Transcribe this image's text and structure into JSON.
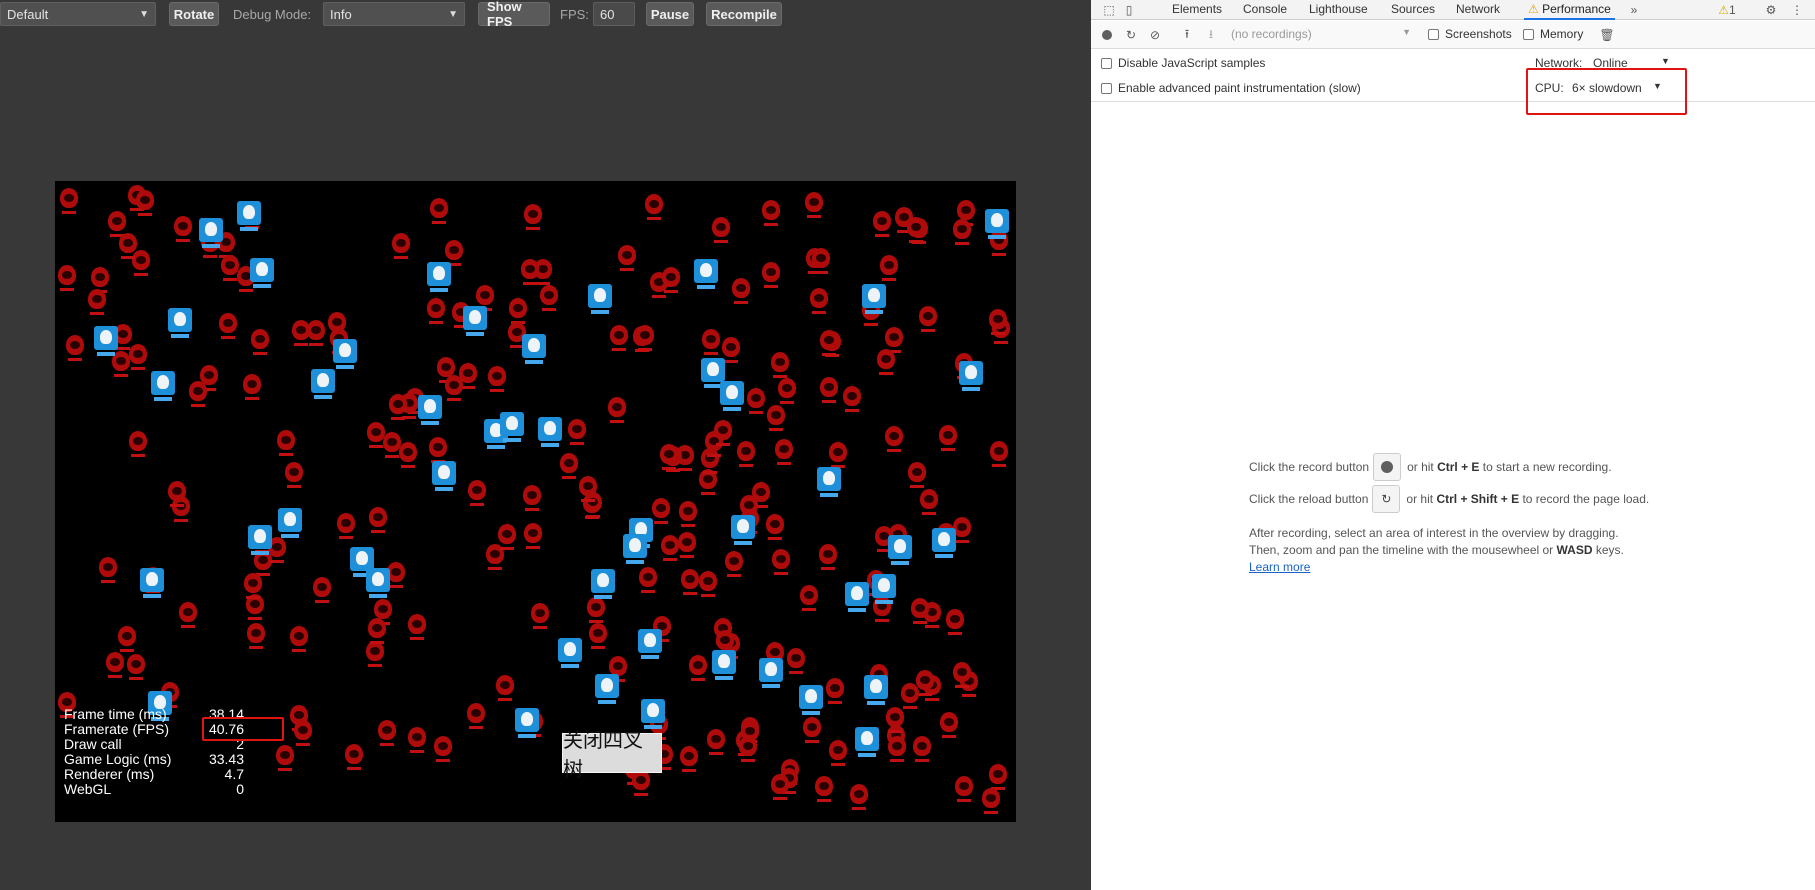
{
  "toolbar": {
    "device_select": "Default",
    "rotate_label": "Rotate",
    "debug_mode_label": "Debug Mode:",
    "debug_mode_value": "Info",
    "show_fps_label": "Show FPS",
    "fps_label": "FPS:",
    "fps_value": "60",
    "pause_label": "Pause",
    "recompile_label": "Recompile"
  },
  "game": {
    "stats": [
      {
        "label": "Frame time (ms)",
        "value": "38.14"
      },
      {
        "label": "Framerate (FPS)",
        "value": "40.76"
      },
      {
        "label": "Draw call",
        "value": "2"
      },
      {
        "label": "Game Logic (ms)",
        "value": "33.43"
      },
      {
        "label": "Renderer (ms)",
        "value": "4.7"
      },
      {
        "label": "WebGL",
        "value": "0"
      }
    ],
    "quadtree_button": "关闭四叉树"
  },
  "devtools": {
    "tabs": [
      "Elements",
      "Console",
      "Lighthouse",
      "Sources",
      "Network",
      "Performance"
    ],
    "active_tab": "Performance",
    "warning_count": "1",
    "recordings_select": "(no recordings)",
    "screenshots_label": "Screenshots",
    "memory_label": "Memory",
    "disable_js_samples_label": "Disable JavaScript samples",
    "advanced_paint_label": "Enable advanced paint instrumentation (slow)",
    "network_label": "Network:",
    "network_value": "Online",
    "cpu_label": "CPU:",
    "cpu_value": "6× slowdown",
    "landing": {
      "line1_pre": "Click the record button",
      "line1_post_a": "or hit",
      "line1_key": "Ctrl + E",
      "line1_post_b": "to start a new recording.",
      "line2_pre": "Click the reload button",
      "line2_post_a": "or hit",
      "line2_key": "Ctrl + Shift + E",
      "line2_post_b": "to record the page load.",
      "line3": "After recording, select an area of interest in the overview by dragging.",
      "line4_pre": "Then, zoom and pan the timeline with the mousewheel or",
      "line4_key": "WASD",
      "line4_post": "keys.",
      "learn_more": "Learn more"
    }
  },
  "colors": {
    "editor_bg": "#383838",
    "highlight_red": "#e11414",
    "devtools_accent": "#1a73e8",
    "sprite_red": "#b00b0b",
    "sprite_blue": "#1e8fd9"
  }
}
